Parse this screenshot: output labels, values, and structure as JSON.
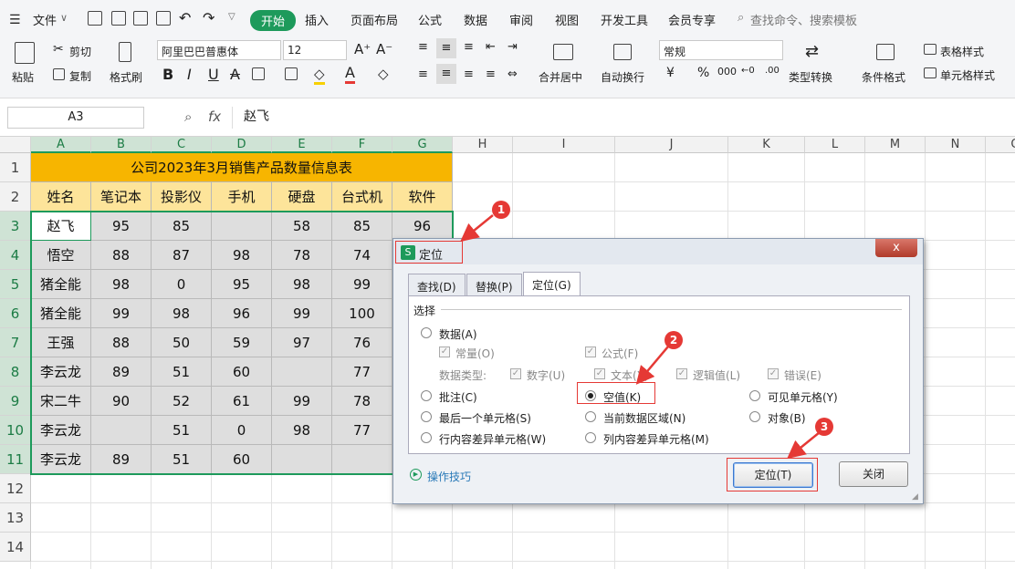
{
  "menu": {
    "file": "文件",
    "tabs": [
      "开始",
      "插入",
      "页面布局",
      "公式",
      "数据",
      "审阅",
      "视图",
      "开发工具",
      "会员专享"
    ],
    "search_placeholder": "查找命令、搜索模板"
  },
  "ribbon": {
    "paste": "粘贴",
    "cut": "剪切",
    "copy": "复制",
    "format_painter": "格式刷",
    "font_name": "阿里巴巴普惠体",
    "font_size": "12",
    "bold": "B",
    "italic": "I",
    "underline": "U",
    "strike": "A",
    "merge_center": "合并居中",
    "wrap_text": "自动换行",
    "number_format": "常规",
    "currency": "¥",
    "percent": "%",
    "thousands": "000",
    "type_convert": "类型转换",
    "cond_format": "条件格式",
    "table_style": "表格样式",
    "cell_style": "单元格样式"
  },
  "formula_bar": {
    "name_box": "A3",
    "fx": "fx",
    "value": "赵飞"
  },
  "grid": {
    "columns": [
      "A",
      "B",
      "C",
      "D",
      "E",
      "F",
      "G",
      "H",
      "I",
      "J",
      "K",
      "L",
      "M",
      "N",
      "O"
    ],
    "rows": [
      "1",
      "2",
      "3",
      "4",
      "5",
      "6",
      "7",
      "8",
      "9",
      "10",
      "11",
      "12",
      "13",
      "14"
    ],
    "title": "公司2023年3月销售产品数量信息表",
    "headers": [
      "姓名",
      "笔记本",
      "投影仪",
      "手机",
      "硬盘",
      "台式机",
      "软件"
    ],
    "data": [
      [
        "赵飞",
        "95",
        "85",
        "",
        "58",
        "85",
        "96"
      ],
      [
        "悟空",
        "88",
        "87",
        "98",
        "78",
        "74",
        ""
      ],
      [
        "猪全能",
        "98",
        "0",
        "95",
        "98",
        "99",
        ""
      ],
      [
        "猪全能",
        "99",
        "98",
        "96",
        "99",
        "100",
        ""
      ],
      [
        "王强",
        "88",
        "50",
        "59",
        "97",
        "76",
        ""
      ],
      [
        "李云龙",
        "89",
        "51",
        "60",
        "",
        "77",
        ""
      ],
      [
        "宋二牛",
        "90",
        "52",
        "61",
        "99",
        "78",
        ""
      ],
      [
        "李云龙",
        "",
        "51",
        "0",
        "98",
        "77",
        ""
      ],
      [
        "李云龙",
        "89",
        "51",
        "60",
        "",
        "",
        ""
      ]
    ]
  },
  "dialog": {
    "title": "定位",
    "close": "x",
    "tabs": [
      "查找(D)",
      "替换(P)",
      "定位(G)"
    ],
    "group_label": "选择",
    "options": {
      "data": "数据(A)",
      "const": "常量(O)",
      "formula": "公式(F)",
      "data_type": "数据类型:",
      "number": "数字(U)",
      "text": "文本(X)",
      "logic": "逻辑值(L)",
      "error": "错误(E)",
      "comment": "批注(C)",
      "blank": "空值(K)",
      "visible": "可见单元格(Y)",
      "last_cell": "最后一个单元格(S)",
      "current_region": "当前数据区域(N)",
      "object": "对象(B)",
      "row_diff": "行内容差异单元格(W)",
      "col_diff": "列内容差异单元格(M)"
    },
    "tips": "操作技巧",
    "ok": "定位(T)",
    "cancel": "关闭"
  },
  "badges": [
    "1",
    "2",
    "3"
  ],
  "colors": {
    "accent": "#1d9a5b",
    "title_fill": "#f7b500",
    "header_fill": "#fde49a",
    "annotation": "#e53935"
  }
}
